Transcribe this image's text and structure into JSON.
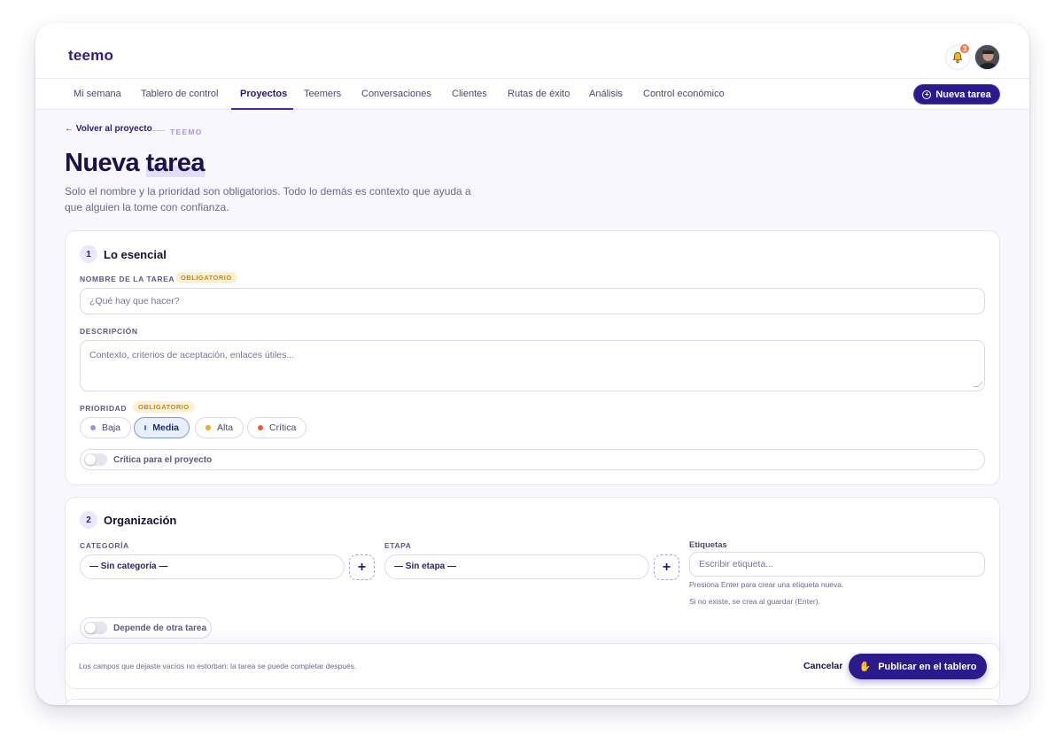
{
  "app": {
    "logo": "teemo",
    "notification_count": "3"
  },
  "nav": {
    "items": [
      {
        "label": "Mi semana"
      },
      {
        "label": "Tablero de control"
      },
      {
        "label": "Proyectos"
      },
      {
        "label": "Teemers"
      },
      {
        "label": "Conversaciones"
      },
      {
        "label": "Clientes"
      },
      {
        "label": "Rutas de éxito"
      },
      {
        "label": "Análisis"
      },
      {
        "label": "Control económico"
      }
    ],
    "active": "Proyectos",
    "new_task_label": "Nueva tarea"
  },
  "header": {
    "back_label": "← Volver al proyecto",
    "crumb": "TEEMO",
    "title_plain": "Nueva",
    "title_highlight": "tarea",
    "subtitle": "Solo el nombre y la prioridad son obligatorios. Todo lo demás es contexto que ayuda a que alguien la tome con confianza."
  },
  "section1": {
    "step": "1",
    "title": "Lo esencial",
    "name_label": "NOMBRE DE LA TAREA",
    "required_badge": "OBLIGATORIO",
    "name_placeholder": "¿Qué hay que hacer?",
    "description_label": "DESCRIPCIÓN",
    "description_placeholder": "Contexto, criterios de aceptación, enlaces útiles...",
    "priority_label": "PRIORIDAD",
    "priorities": [
      {
        "label": "Baja",
        "color": "#9b93d6"
      },
      {
        "label": "Media",
        "color": "#3b6fe0"
      },
      {
        "label": "Alta",
        "color": "#f2a91c"
      },
      {
        "label": "Crítica",
        "color": "#ec5b34"
      }
    ],
    "selected_priority": "Media",
    "critical_toggle_label": "Crítica para el proyecto"
  },
  "section2": {
    "step": "2",
    "title": "Organización",
    "category_label": "CATEGORÍA",
    "category_value": "— Sin categoría —",
    "stage_label": "ETAPA",
    "stage_value": "— Sin etapa —",
    "tags_label": "Etiquetas",
    "tags_placeholder": "Escribir etiqueta...",
    "tags_hint1": "Presiona Enter para crear una etiqueta nueva.",
    "tags_hint2": "Si no existe, se crea al guardar (Enter).",
    "depends_toggle_label": "Depende de otra tarea",
    "add_symbol": "+"
  },
  "footer": {
    "note": "Los campos que dejaste vacíos no estorban: la tarea se puede completar después.",
    "cancel_label": "Cancelar",
    "publish_label": "Publicar en el tablero",
    "publish_icon": "✋"
  },
  "colors": {
    "primary": "#2b1a8c",
    "accent": "#6d4df2",
    "required_bg": "#fdf1d4"
  },
  "icons": [
    "bell-icon",
    "plus-circle-icon",
    "hand-icon",
    "resize-handle-icon"
  ]
}
